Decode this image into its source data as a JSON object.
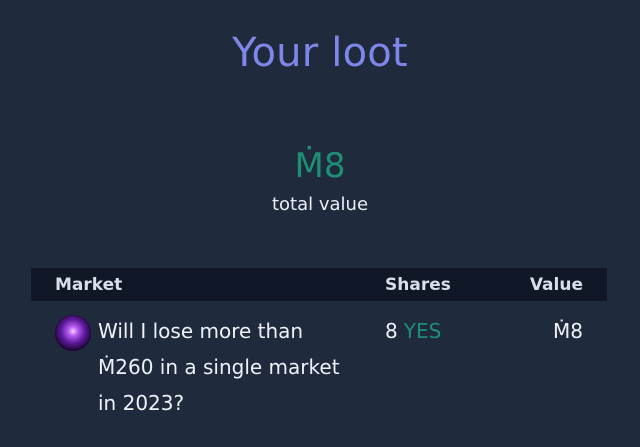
{
  "page": {
    "title": "Your loot"
  },
  "summary": {
    "total_value": "Ṁ8",
    "total_label": "total value"
  },
  "table": {
    "headers": {
      "market": "Market",
      "shares": "Shares",
      "value": "Value"
    },
    "rows": [
      {
        "avatar_icon": "purple-orb-avatar",
        "market": "Will I lose more than Ṁ260 in a single market in 2023?",
        "shares_count": "8",
        "shares_outcome": "YES",
        "value": "Ṁ8"
      }
    ]
  },
  "colors": {
    "background": "#1f2a3c",
    "title": "#7f86ea",
    "accent_green": "#1f8e76",
    "table_header_bg": "#101827",
    "text": "#eef2f8"
  }
}
